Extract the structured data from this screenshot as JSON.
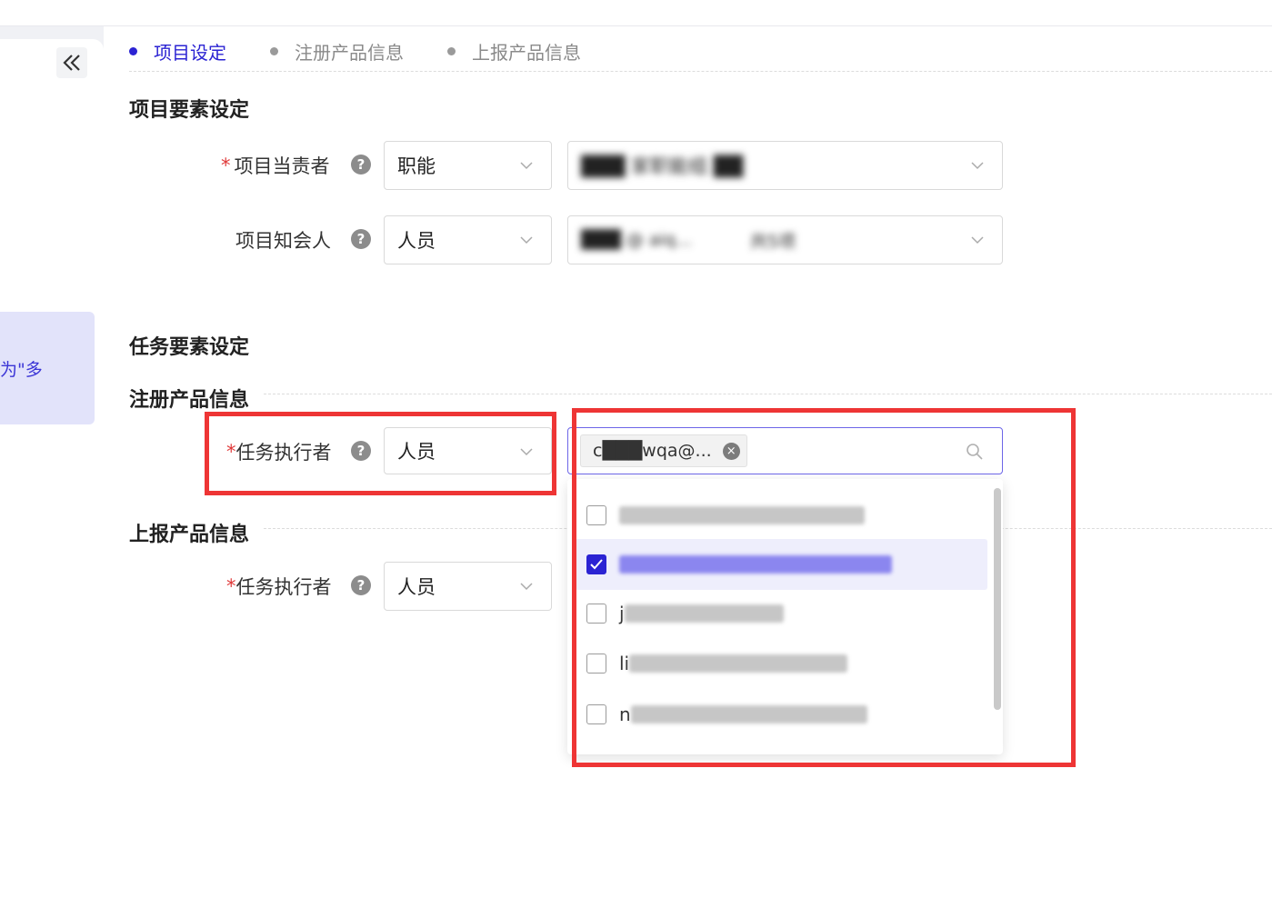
{
  "steps": [
    {
      "label": "项目设定",
      "active": true
    },
    {
      "label": "注册产品信息",
      "active": false
    },
    {
      "label": "上报产品信息",
      "active": false
    }
  ],
  "sidebar": {
    "collapse_icon": "double-chevron-left-icon",
    "note_fragment": "为\"多"
  },
  "sections": {
    "project_elements": "项目要素设定",
    "task_elements": "任务要素设定",
    "register_info": "注册产品信息",
    "report_info": "上报产品信息"
  },
  "fields": {
    "project_owner": {
      "required": true,
      "label": "项目当责者",
      "help": "?",
      "type_value": "职能",
      "value": "███ 家职能组 ██"
    },
    "project_informed": {
      "required": false,
      "label": "项目知会人",
      "help": "?",
      "type_value": "人员",
      "tag": "███ @ aiq...",
      "extra": "共5项"
    },
    "register_executor": {
      "required": true,
      "label": "任务执行者",
      "help": "?",
      "type_value": "人员",
      "tag": "c███wqa@...",
      "tag_close": "×"
    },
    "report_executor": {
      "required": true,
      "label": "任务执行者",
      "help": "?",
      "type_value": "人员"
    }
  },
  "dropdown": {
    "options": [
      {
        "prefix": "",
        "checked": false
      },
      {
        "prefix": "",
        "checked": true
      },
      {
        "prefix": "j",
        "checked": false
      },
      {
        "prefix": "li",
        "checked": false
      },
      {
        "prefix": "n",
        "checked": false
      }
    ]
  },
  "colors": {
    "accent": "#2b23d3",
    "highlight": "#ee3535",
    "required": "#e03a3a"
  }
}
